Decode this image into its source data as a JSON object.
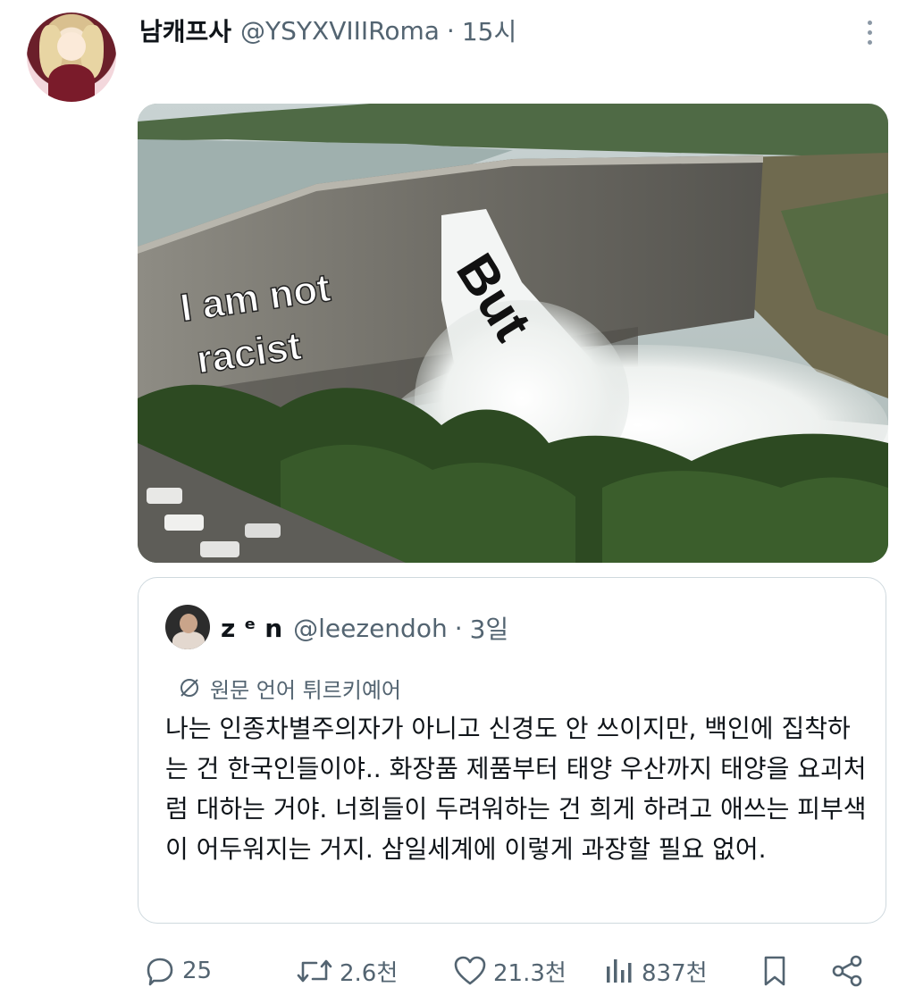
{
  "tweet": {
    "display_name": "남캐프사",
    "handle": "@YSYXVIIIRoma",
    "separator": "·",
    "time": "15시"
  },
  "media": {
    "meme_text_left_line1": "I am not",
    "meme_text_left_line2": "racist",
    "meme_text_right": "But"
  },
  "quote": {
    "display_name": "z ᵉ n",
    "handle": "@leezendoh",
    "separator": "·",
    "time": "3일",
    "translate_label": "원문 언어 튀르키예어",
    "text": "나는 인종차별주의자가 아니고 신경도 안 쓰이지만, 백인에 집착하는 건 한국인들이야.. 화장품 제품부터 태양 우산까지 태양을 요괴처럼 대하는 거야. 너희들이 두려워하는 건 희게 하려고 애쓰는 피부색이 어두워지는 거지. 삼일세계에 이렇게 과장할 필요 없어."
  },
  "actions": {
    "reply_count": "25",
    "retweet_count": "2.6천",
    "like_count": "21.3천",
    "view_count": "837천"
  }
}
